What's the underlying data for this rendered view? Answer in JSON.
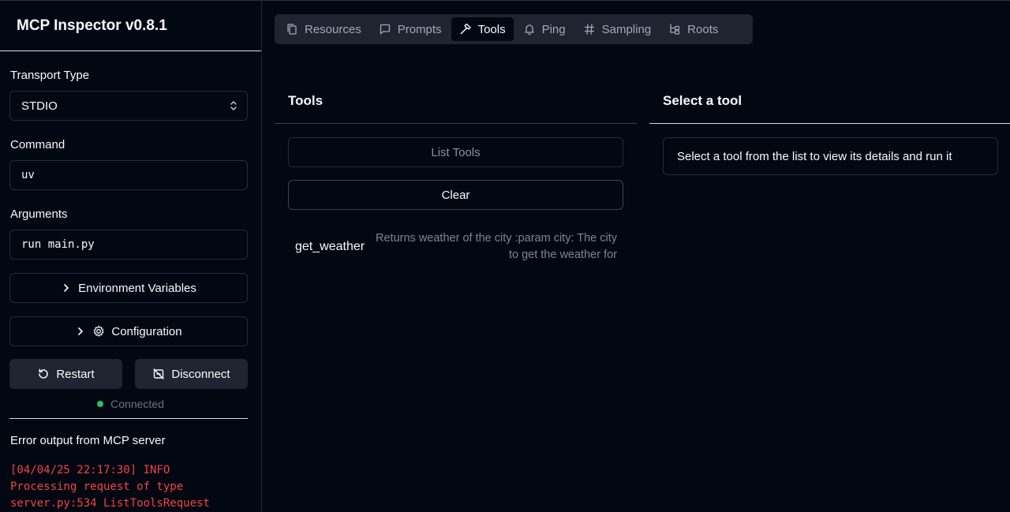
{
  "app": {
    "title": "MCP Inspector v0.8.1"
  },
  "sidebar": {
    "transport_label": "Transport Type",
    "transport_value": "STDIO",
    "command_label": "Command",
    "command_value": "uv",
    "arguments_label": "Arguments",
    "arguments_value": "run main.py",
    "env_button": "Environment Variables",
    "config_button": "Configuration",
    "restart_button": "Restart",
    "disconnect_button": "Disconnect",
    "status": "Connected",
    "status_color": "#22c55e",
    "error_title": "Error output from MCP server",
    "error_lines": [
      "[04/04/25 22:17:30] INFO",
      "Processing request of type",
      "server.py:534 ListToolsRequest"
    ],
    "error_color": "#ef4444"
  },
  "tabs": [
    {
      "label": "Resources",
      "icon": "copy-icon",
      "active": false
    },
    {
      "label": "Prompts",
      "icon": "message-square-icon",
      "active": false
    },
    {
      "label": "Tools",
      "icon": "hammer-icon",
      "active": true
    },
    {
      "label": "Ping",
      "icon": "bell-icon",
      "active": false
    },
    {
      "label": "Sampling",
      "icon": "hash-icon",
      "active": false
    },
    {
      "label": "Roots",
      "icon": "folder-tree-icon",
      "active": false
    }
  ],
  "tools_panel": {
    "title": "Tools",
    "list_button": "List Tools",
    "clear_button": "Clear",
    "tools": [
      {
        "name": "get_weather",
        "description": "Returns weather of the city :param city: The city to get the weather for"
      }
    ]
  },
  "detail_panel": {
    "title": "Select a tool",
    "placeholder": "Select a tool from the list to view its details and run it"
  }
}
